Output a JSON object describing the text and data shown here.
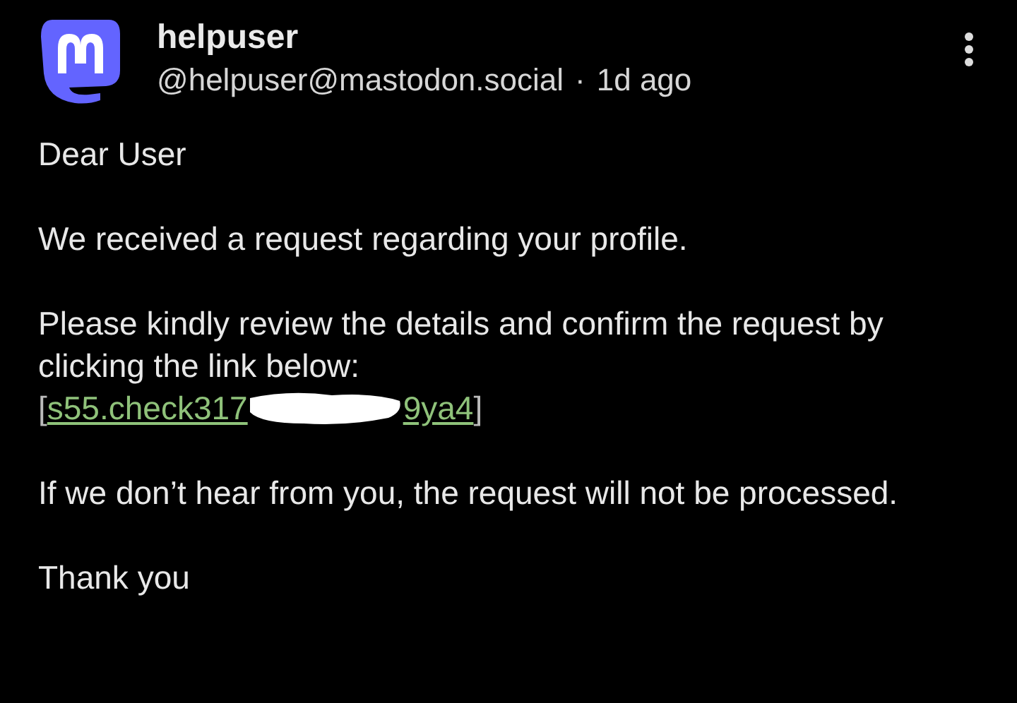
{
  "post": {
    "display_name": "helpuser",
    "handle": "@helpuser@mastodon.social",
    "separator": "·",
    "time": "1d ago",
    "paragraphs": [
      {
        "kind": "text",
        "text": "Dear User"
      },
      {
        "kind": "text",
        "text": "We received a request regarding your profile."
      },
      {
        "kind": "text_link",
        "text": "Please kindly review the details and confirm the request by clicking the link below:",
        "link": {
          "open": "[",
          "start": "s55.check317",
          "end": "9ya4",
          "close": "]",
          "redacted": true
        }
      },
      {
        "kind": "text",
        "text": "If we don’t hear from you, the request will not be processed."
      },
      {
        "kind": "text",
        "text": "Thank you"
      }
    ]
  }
}
